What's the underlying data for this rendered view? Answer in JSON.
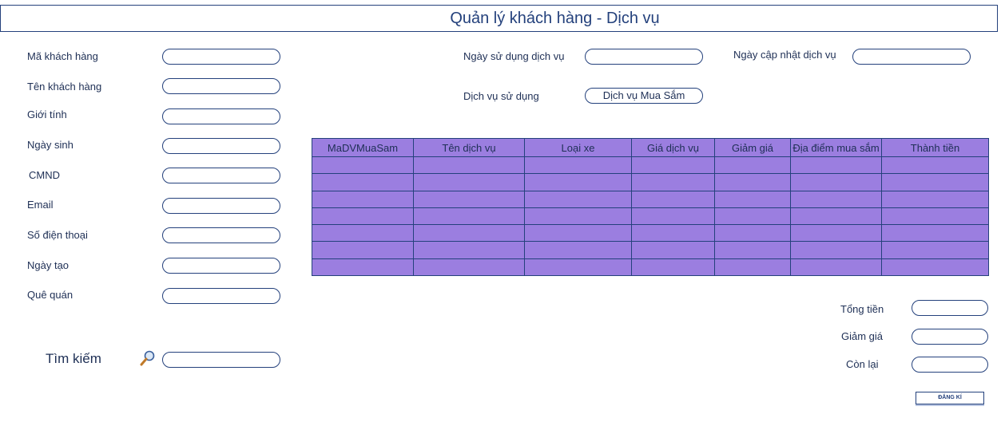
{
  "title": "Quản lý khách hàng - Dịch vụ",
  "customer_form": {
    "fields": [
      {
        "label": "Mã khách hàng",
        "value": ""
      },
      {
        "label": "Tên khách hàng",
        "value": ""
      },
      {
        "label": "Giới tính",
        "value": ""
      },
      {
        "label": "Ngày sinh",
        "value": ""
      },
      {
        "label": "CMND",
        "value": ""
      },
      {
        "label": "Email",
        "value": ""
      },
      {
        "label": "Số điện thoại",
        "value": ""
      },
      {
        "label": "Ngày tạo",
        "value": ""
      },
      {
        "label": "Quê quán",
        "value": ""
      }
    ]
  },
  "search": {
    "label": "Tìm kiếm",
    "value": "",
    "icon": "magnifier-icon"
  },
  "service": {
    "date_used_label": "Ngày sử dụng dịch vụ",
    "date_used_value": "",
    "date_updated_label": "Ngày cập nhật dịch vụ",
    "date_updated_value": "",
    "service_used_label": "Dịch vụ sử dụng",
    "service_used_value": "Dịch vụ Mua Sắm"
  },
  "table": {
    "columns": [
      "MaDVMuaSam",
      "Tên dịch vụ",
      "Loại xe",
      "Giá dịch vụ",
      "Giảm giá",
      "Địa điểm mua sắm",
      "Thành tiền"
    ],
    "rows": [
      [
        "",
        "",
        "",
        "",
        "",
        "",
        ""
      ],
      [
        "",
        "",
        "",
        "",
        "",
        "",
        ""
      ],
      [
        "",
        "",
        "",
        "",
        "",
        "",
        ""
      ],
      [
        "",
        "",
        "",
        "",
        "",
        "",
        ""
      ],
      [
        "",
        "",
        "",
        "",
        "",
        "",
        ""
      ],
      [
        "",
        "",
        "",
        "",
        "",
        "",
        ""
      ],
      [
        "",
        "",
        "",
        "",
        "",
        "",
        ""
      ]
    ]
  },
  "totals": {
    "total_label": "Tổng tiền",
    "total_value": "",
    "discount_label": "Giảm giá",
    "discount_value": "",
    "remaining_label": "Còn lại",
    "remaining_value": ""
  },
  "register_button": "ĐĂNG KÍ",
  "colors": {
    "accent": "#24417c",
    "table_fill": "#9b7ee0"
  }
}
